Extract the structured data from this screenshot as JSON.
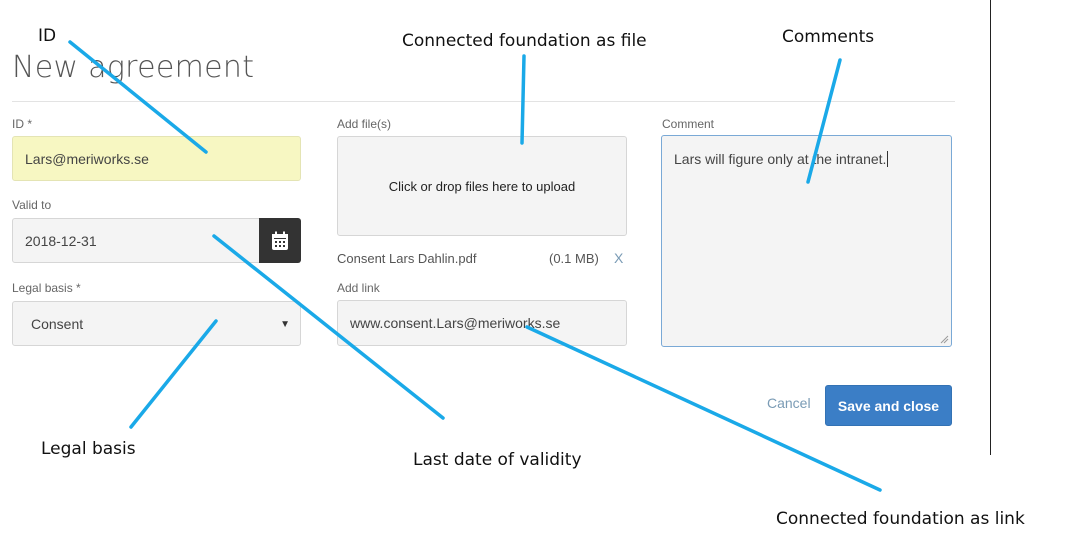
{
  "page": {
    "title": "New agreement"
  },
  "form": {
    "id": {
      "label": "ID *",
      "value": "Lars@meriworks.se"
    },
    "valid_to": {
      "label": "Valid to",
      "value": "2018-12-31"
    },
    "legal_basis": {
      "label": "Legal basis *",
      "selected": "Consent"
    },
    "add_files": {
      "label": "Add file(s)",
      "dropzone_text": "Click or drop files here to upload",
      "file": {
        "name": "Consent Lars Dahlin.pdf",
        "size": "(0.1 MB)",
        "remove": "X"
      }
    },
    "add_link": {
      "label": "Add link",
      "value": "www.consent.Lars@meriworks.se"
    },
    "comment": {
      "label": "Comment",
      "value": "Lars will figure only at the intranet."
    }
  },
  "actions": {
    "cancel_label": "Cancel",
    "save_label": "Save and close"
  },
  "annotations": {
    "id": "ID",
    "file": "Connected foundation as file",
    "comments": "Comments",
    "legal_basis": "Legal basis",
    "validity": "Last date of validity",
    "link": "Connected foundation as link"
  },
  "colors": {
    "primary": "#3b7ec6",
    "highlight_field": "#f7f7c2",
    "annotation_line": "#1aa9e8"
  },
  "icons": {
    "calendar": "calendar-icon",
    "dropdown": "chevron-down-icon",
    "remove": "close-icon"
  }
}
